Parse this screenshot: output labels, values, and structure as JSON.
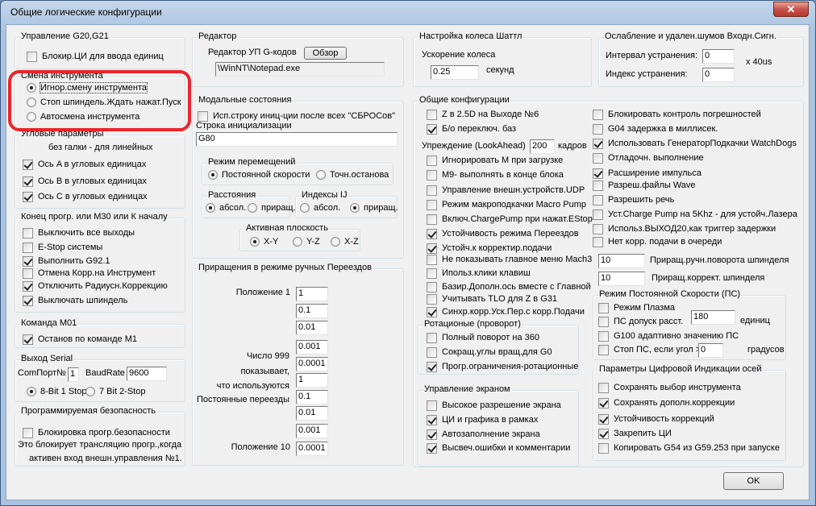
{
  "window": {
    "title": "Общие логические конфигурации",
    "close": "✕"
  },
  "g20": {
    "title": "Управление G20,G21",
    "block": {
      "label": "Блокир.ЦИ для ввода единиц",
      "checked": false
    }
  },
  "tool": {
    "title": "Смена инструмента",
    "options": [
      {
        "label": "Игнор.смену инструмента",
        "checked": true
      },
      {
        "label": "Стоп шпиндель.Ждать нажат.Пуск",
        "checked": false
      },
      {
        "label": "Автосмена инструмента",
        "checked": false
      }
    ]
  },
  "angular": {
    "title": "Угловые параметры",
    "note": "без галки - для линейных",
    "items": [
      {
        "label": "Ось A в угловых единицах",
        "checked": true
      },
      {
        "label": "Ось B в угловых единицах",
        "checked": true
      },
      {
        "label": "Ось C в угловых единицах",
        "checked": true
      }
    ]
  },
  "endprog": {
    "title": "Конец прогр. или M30 или К началу",
    "items": [
      {
        "label": "Выключить все выходы",
        "checked": false
      },
      {
        "label": "E-Stop системы",
        "checked": false
      },
      {
        "label": "Выполнить G92.1",
        "checked": true
      },
      {
        "label": "Отмена Корр.на Инструмент",
        "checked": false
      },
      {
        "label": "Отключить Радиусн.Коррекцию",
        "checked": true
      },
      {
        "label": "Выключать шпиндель",
        "checked": true
      }
    ]
  },
  "m01": {
    "title": "Команда M01",
    "stop": {
      "label": "Останов по команде M1",
      "checked": true
    }
  },
  "serial": {
    "title": "Выход Serial",
    "port_label": "ComПорт№",
    "port": "1",
    "baud_label": "BaudRate",
    "baud": "9600",
    "modes": [
      {
        "label": "8-Bit 1 Stop",
        "checked": true
      },
      {
        "label": "7 Bit 2-Stop",
        "checked": false
      }
    ]
  },
  "safety": {
    "title": "Программируемая безопасность",
    "block": {
      "label": "Блокировка прогр.безопасности",
      "checked": false
    },
    "note1": "Это блокирует трансляцию прогр.,когда",
    "note2": "активен вход внешн.управления №1."
  },
  "editor": {
    "title": "Редактор",
    "label": "Редактор УП G-кодов",
    "browse": "Обзор",
    "path": "\\WinNT\\Notepad.exe"
  },
  "modal": {
    "title": "Модальные состояния",
    "use_init": {
      "label": "Исп.строку иниц-ции после всех \"СБРОСов\"",
      "checked": false
    },
    "init_label": "Строка инициализации",
    "init": "G80",
    "motion": {
      "title": "Режим перемещений",
      "options": [
        {
          "label": "Постоянной скорости",
          "checked": true
        },
        {
          "label": "Точн.останова",
          "checked": false
        }
      ]
    },
    "distance": {
      "title": "Расстояния",
      "options": [
        {
          "label": "абсол.",
          "checked": true
        },
        {
          "label": "приращ.",
          "checked": false
        }
      ]
    },
    "ij": {
      "title": "Индексы IJ",
      "options": [
        {
          "label": "абсол.",
          "checked": false
        },
        {
          "label": "приращ.",
          "checked": true
        }
      ]
    },
    "plane": {
      "title": "Активная плоскость",
      "options": [
        {
          "label": "X-Y",
          "checked": true
        },
        {
          "label": "Y-Z",
          "checked": false
        },
        {
          "label": "X-Z",
          "checked": false
        }
      ]
    }
  },
  "jog": {
    "title": "Приращения в режиме ручных Переездов",
    "pos1": "Положение 1",
    "pos10": "Положение 10",
    "n1": "Число 999",
    "n2": "показывает,",
    "n3": "что используются",
    "n4": "Постоянные переезды",
    "values": [
      "1",
      "0.1",
      "0.01",
      "0.001",
      "0.0001",
      "1",
      "0.1",
      "0.01",
      "0.001",
      "0.0001"
    ]
  },
  "shuttle": {
    "title": "Настройка колеса Шаттл",
    "label": "Ускорение колеса",
    "value": "0.25",
    "unit": "секунд"
  },
  "debounce": {
    "title": "Ослабление и удален.шумов Входн.Сигн.",
    "interval_label": "Интервал устранения:",
    "interval": "0",
    "unit": "x 40us",
    "index_label": "Индекс устранения:",
    "index": "0"
  },
  "general": {
    "title": "Общие конфигурации",
    "lookahead_label": "Упреждение (LookAhead)",
    "lookahead": "200",
    "lookahead_unit": "кадров",
    "left_top": [
      {
        "label": "Z в 2.5D на Выходе №6",
        "checked": false
      },
      {
        "label": "Б/о переключ. баз",
        "checked": true
      }
    ],
    "left": [
      {
        "label": "Игнорировать M при загрузке",
        "checked": false
      },
      {
        "label": "M9- выполнять в конце блока",
        "checked": false
      },
      {
        "label": "Управление внешн.устройств.UDP",
        "checked": false
      },
      {
        "label": "Режим макроподкачки Macro Pump",
        "checked": false
      },
      {
        "label": "Включ.ChargePump при нажат.EStop",
        "checked": false
      },
      {
        "label": "Устойчивость режима Переездов",
        "checked": true
      },
      {
        "label": "Устойч.к корректир.подачи",
        "checked": true
      },
      {
        "label": "Не показывать главное меню Mach3",
        "checked": false
      },
      {
        "label": "Ипольз.клики клавиш",
        "checked": false
      },
      {
        "label": "Базир.Дополн.ось вместе с Главной",
        "checked": false
      },
      {
        "label": "Учитывать TLO для Z в G31",
        "checked": false
      },
      {
        "label": "Синхр.корр.Уск.Пер.с корр.Подачи",
        "checked": true
      }
    ],
    "right": [
      {
        "label": "Блокировать контроль погрешностей",
        "checked": false
      },
      {
        "label": "G04 задержка в миллисек.",
        "checked": false
      },
      {
        "label": "Использовать ГенераторПодкачки WatchDogs",
        "checked": true
      },
      {
        "label": "Отладочн. выполнение",
        "checked": false
      },
      {
        "label": "Расширение импульса",
        "checked": true
      },
      {
        "label": "Разреш.файлы Wave",
        "checked": false
      },
      {
        "label": "Разрешить речь",
        "checked": false
      },
      {
        "label": "Уст.Charge Pump на 5Khz - для устойч.Лазера",
        "checked": false
      },
      {
        "label": "Использ.ВЫХОД20,как триггер задержки",
        "checked": false
      },
      {
        "label": "Нет корр. подачи в очереди",
        "checked": false
      }
    ],
    "spindle_jog": "10",
    "spindle_jog_label": "Приращ.ручн.поворота шпинделя",
    "spindle_ovr": "10",
    "spindle_ovr_label": "Приращ.коррект. шпинделя"
  },
  "rotary": {
    "title": "Ротационые (проворот)",
    "items": [
      {
        "label": "Полный поворот на 360",
        "checked": false
      },
      {
        "label": "Сокращ.углы вращ.для G0",
        "checked": false
      },
      {
        "label": "Прогр.ограничения-ротационные",
        "checked": true
      }
    ]
  },
  "css": {
    "title": "Режим Постоянной Скорости (ПС)",
    "items": [
      {
        "label": "Режим Плазма",
        "checked": false
      },
      {
        "label": "ПС допуск расст.",
        "checked": false
      },
      {
        "label": "G100 адаптивно значению ПС",
        "checked": false
      },
      {
        "label": "Стоп ПС, если угол >",
        "checked": false
      }
    ],
    "tolerance": "180",
    "tol_unit": "единиц",
    "angle": "0",
    "angle_unit": "градусов"
  },
  "screen": {
    "title": "Управление экраном",
    "items": [
      {
        "label": "Высокое разрешение экрана",
        "checked": false
      },
      {
        "label": "ЦИ и графика в рамках",
        "checked": true
      },
      {
        "label": "Автозаполнение экрана",
        "checked": true
      },
      {
        "label": "Высвеч.ошибки и комментарии",
        "checked": true
      }
    ]
  },
  "dro": {
    "title": "Параметры Цифровой Индикации осей",
    "items": [
      {
        "label": "Сохранять выбор инструмента",
        "checked": false
      },
      {
        "label": "Сохранять дополн.коррекции",
        "checked": true
      },
      {
        "label": "Устойчивость коррекций",
        "checked": true
      },
      {
        "label": "Закрепить ЦИ",
        "checked": true
      },
      {
        "label": "Копировать G54 из G59.253 при запуске",
        "checked": false
      }
    ]
  },
  "ok": "OK"
}
